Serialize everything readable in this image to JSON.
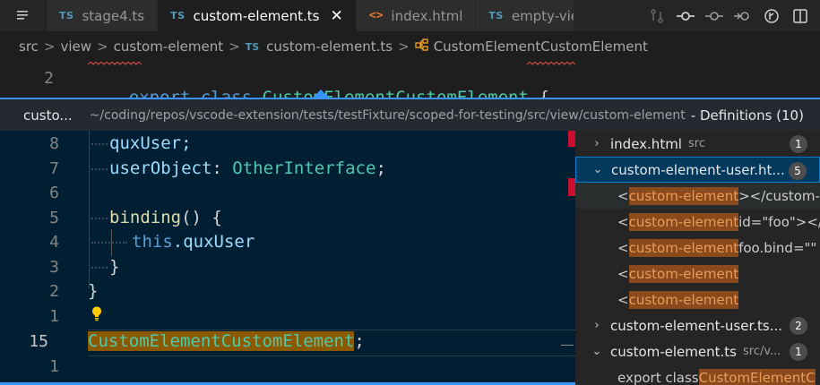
{
  "tabs": [
    {
      "icon": "TS",
      "label": "stage4.ts"
    },
    {
      "icon": "TS",
      "label": "custom-element.ts",
      "close": "✕"
    },
    {
      "icon": "<>",
      "label": "index.html"
    },
    {
      "icon": "TS",
      "label": "empty-vie"
    }
  ],
  "breadcrumbs": {
    "parts": [
      "src",
      "view",
      "custom-element"
    ],
    "file_icon": "TS",
    "file": "custom-element.ts",
    "symbol": "CustomElementCustomElement",
    "separator": ">"
  },
  "editor_top": {
    "line_number": "2",
    "keyword_export": "export",
    "keyword_class": "class",
    "class_name": "CustomElementCustomElement",
    "brace": "{"
  },
  "peek": {
    "title": "custo...",
    "path": "~/coding/repos/vscode-extension/tests/testFixture/scoped-for-testing/src/view/custom-element",
    "meta": "- Definitions (10)"
  },
  "peek_code": {
    "lines": [
      {
        "num": "8",
        "text": "quxUser;"
      },
      {
        "num": "7",
        "prop": "userObject",
        "colon": ": ",
        "type": "OtherInterface",
        "semi": ";"
      },
      {
        "num": "6"
      },
      {
        "num": "5",
        "fn": "binding",
        "rest": "() {"
      },
      {
        "num": "4",
        "kw": "this",
        "rest": ".quxUser"
      },
      {
        "num": "3",
        "text": "}"
      },
      {
        "num": "2",
        "text": "}"
      },
      {
        "num": "1"
      },
      {
        "num": "15",
        "match": "CustomElementCustomElement",
        "rest": ";"
      },
      {
        "num": "1"
      }
    ]
  },
  "references": {
    "files": [
      {
        "name": "index.html",
        "dir": "src",
        "count": "1",
        "chevron": "›"
      },
      {
        "name": "custom-element-user.ht...",
        "dir": "",
        "count": "5",
        "chevron": "⌄"
      },
      {
        "name": "custom-element-user.ts...",
        "dir": "",
        "count": "2",
        "chevron": "›"
      },
      {
        "name": "custom-element.ts",
        "dir": "src/v...",
        "count": "1",
        "chevron": "⌄"
      }
    ],
    "matches": [
      {
        "pre": "<",
        "hl": "custom-element",
        "post": "></custom-e"
      },
      {
        "pre": "<",
        "hl": "custom-element",
        "post": " id=\"foo\"></"
      },
      {
        "pre": "<",
        "hl": "custom-element",
        "post": " foo.bind=\"\""
      },
      {
        "pre": "<",
        "hl": "custom-element",
        "post": ""
      },
      {
        "pre": "<",
        "hl": "custom-element",
        "post": ""
      }
    ],
    "last_match": {
      "pre": "export class ",
      "hl": "CustomElementC",
      "post": ""
    }
  }
}
